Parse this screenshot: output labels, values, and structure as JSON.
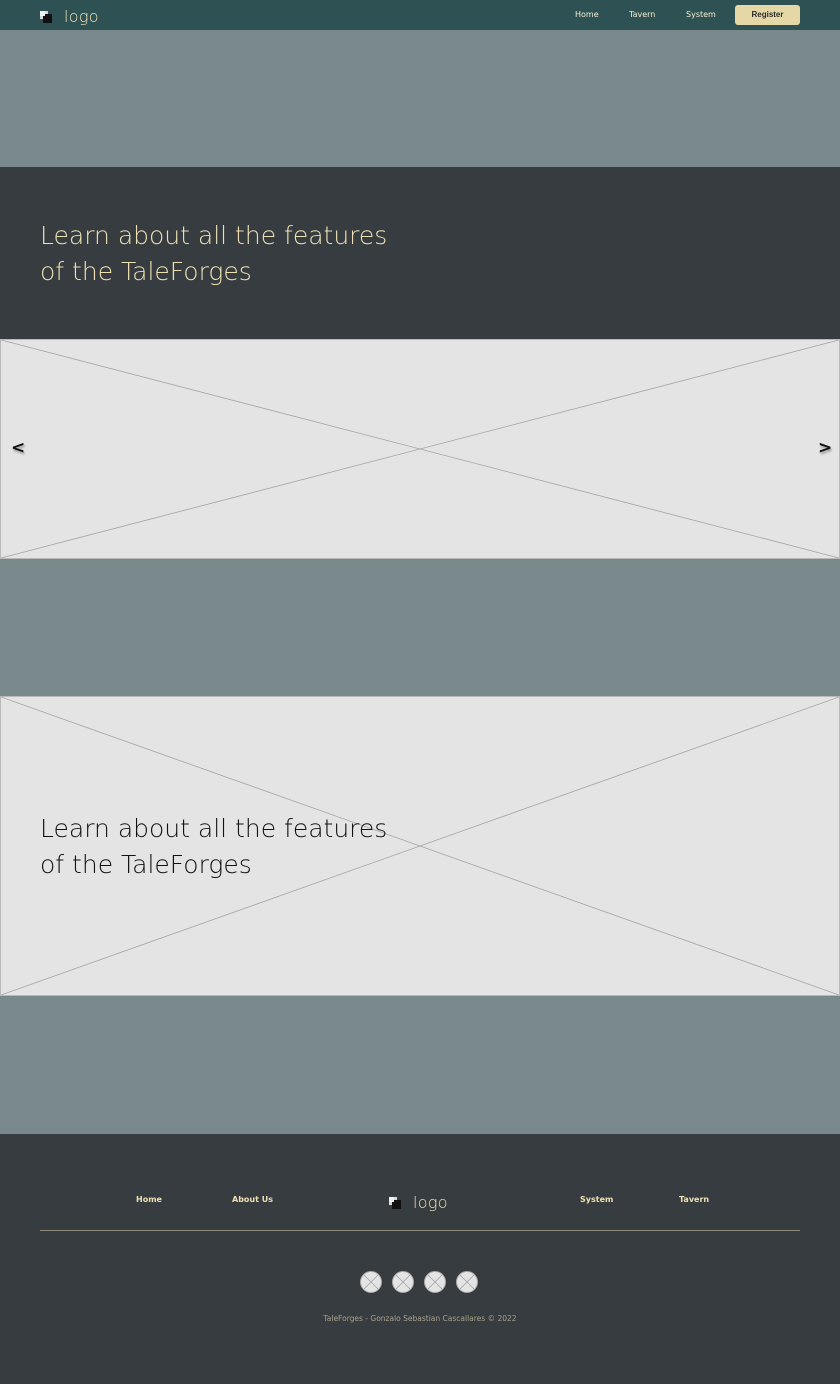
{
  "nav": {
    "logo_text": "logo",
    "links": [
      "Home",
      "Tavern",
      "System"
    ],
    "register_label": "Register"
  },
  "hero": {
    "title_line1": "Learn about all the features",
    "title_line2": "of the TaleForges"
  },
  "carousel": {
    "prev_label": "<",
    "next_label": ">"
  },
  "feature": {
    "title_line1": "Learn about all the features",
    "title_line2": "of the TaleForges"
  },
  "footer": {
    "links_left": [
      "Home",
      "About Us"
    ],
    "links_right": [
      "System",
      "Tavern"
    ],
    "logo_text": "logo",
    "social_icons": [
      "social-icon-1",
      "social-icon-2",
      "social-icon-3",
      "social-icon-4"
    ],
    "copyright": "TaleForges - Gonzalo Sebastian Cascallares © 2022"
  },
  "colors": {
    "nav_bg": "#2e5253",
    "accent": "#e5d8a6",
    "dark_band": "#363c3f",
    "grey_band": "#79888b",
    "placeholder": "#e4e4e4"
  }
}
